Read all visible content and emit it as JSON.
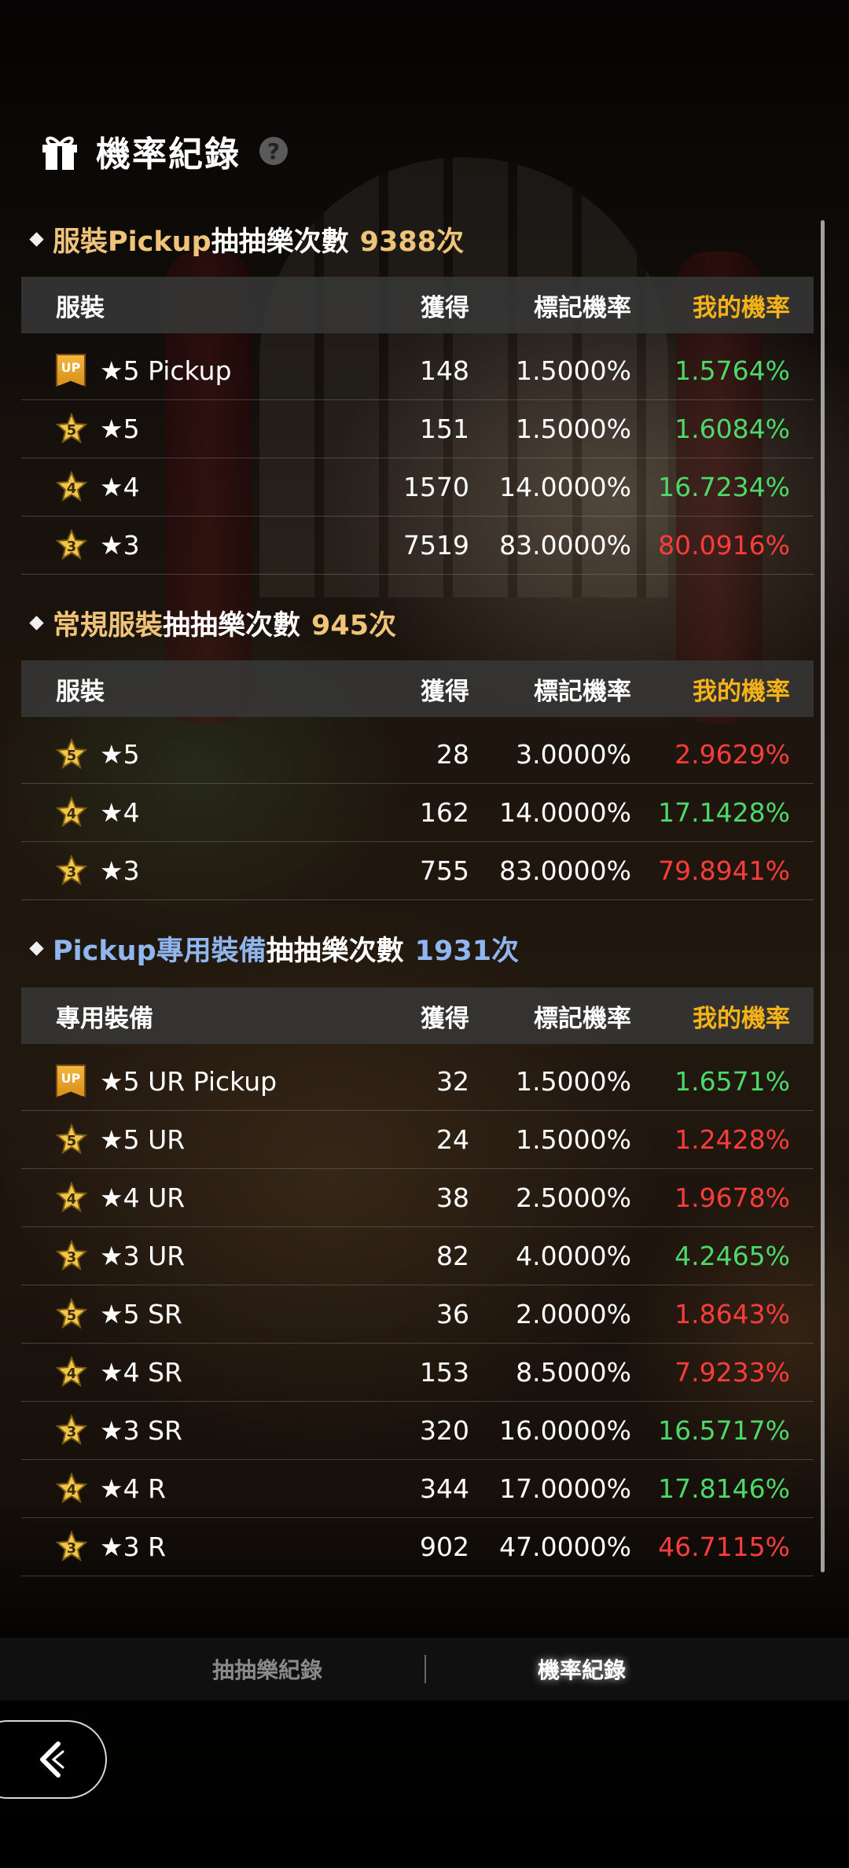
{
  "header": {
    "title": "機率紀錄",
    "help_icon": "question-mark-icon",
    "title_icon": "gift-icon"
  },
  "sections": [
    {
      "title_colored": "服裝Pickup",
      "title_rest": "抽抽樂次數",
      "count": "9388次",
      "title_color": "#efc37a",
      "columns": {
        "name": "服裝",
        "obtained": "獲得",
        "marked_rate": "標記機率",
        "my_rate": "我的機率"
      },
      "rows": [
        {
          "badge": "UP",
          "name": "★5 Pickup",
          "obtained": "148",
          "marked_rate": "1.5000%",
          "my_rate": "1.5764%",
          "my_rate_status": "green"
        },
        {
          "badge": "5",
          "name": "★5",
          "obtained": "151",
          "marked_rate": "1.5000%",
          "my_rate": "1.6084%",
          "my_rate_status": "green"
        },
        {
          "badge": "4",
          "name": "★4",
          "obtained": "1570",
          "marked_rate": "14.0000%",
          "my_rate": "16.7234%",
          "my_rate_status": "green"
        },
        {
          "badge": "3",
          "name": "★3",
          "obtained": "7519",
          "marked_rate": "83.0000%",
          "my_rate": "80.0916%",
          "my_rate_status": "red"
        }
      ]
    },
    {
      "title_colored": "常規服裝",
      "title_rest": "抽抽樂次數",
      "count": "945次",
      "title_color": "#efc37a",
      "columns": {
        "name": "服裝",
        "obtained": "獲得",
        "marked_rate": "標記機率",
        "my_rate": "我的機率"
      },
      "rows": [
        {
          "badge": "5",
          "name": "★5",
          "obtained": "28",
          "marked_rate": "3.0000%",
          "my_rate": "2.9629%",
          "my_rate_status": "red"
        },
        {
          "badge": "4",
          "name": "★4",
          "obtained": "162",
          "marked_rate": "14.0000%",
          "my_rate": "17.1428%",
          "my_rate_status": "green"
        },
        {
          "badge": "3",
          "name": "★3",
          "obtained": "755",
          "marked_rate": "83.0000%",
          "my_rate": "79.8941%",
          "my_rate_status": "red"
        }
      ]
    },
    {
      "title_colored": "Pickup專用裝備",
      "title_rest": "抽抽樂次數",
      "count": "1931次",
      "title_color": "#8fb6ee",
      "columns": {
        "name": "專用裝備",
        "obtained": "獲得",
        "marked_rate": "標記機率",
        "my_rate": "我的機率"
      },
      "rows": [
        {
          "badge": "UP",
          "name": "★5 UR Pickup",
          "obtained": "32",
          "marked_rate": "1.5000%",
          "my_rate": "1.6571%",
          "my_rate_status": "green"
        },
        {
          "badge": "5",
          "name": "★5 UR",
          "obtained": "24",
          "marked_rate": "1.5000%",
          "my_rate": "1.2428%",
          "my_rate_status": "red"
        },
        {
          "badge": "4",
          "name": "★4 UR",
          "obtained": "38",
          "marked_rate": "2.5000%",
          "my_rate": "1.9678%",
          "my_rate_status": "red"
        },
        {
          "badge": "3",
          "name": "★3 UR",
          "obtained": "82",
          "marked_rate": "4.0000%",
          "my_rate": "4.2465%",
          "my_rate_status": "green"
        },
        {
          "badge": "5",
          "name": "★5 SR",
          "obtained": "36",
          "marked_rate": "2.0000%",
          "my_rate": "1.8643%",
          "my_rate_status": "red"
        },
        {
          "badge": "4",
          "name": "★4 SR",
          "obtained": "153",
          "marked_rate": "8.5000%",
          "my_rate": "7.9233%",
          "my_rate_status": "red"
        },
        {
          "badge": "3",
          "name": "★3 SR",
          "obtained": "320",
          "marked_rate": "16.0000%",
          "my_rate": "16.5717%",
          "my_rate_status": "green"
        },
        {
          "badge": "4",
          "name": "★4 R",
          "obtained": "344",
          "marked_rate": "17.0000%",
          "my_rate": "17.8146%",
          "my_rate_status": "green"
        },
        {
          "badge": "3",
          "name": "★3 R",
          "obtained": "902",
          "marked_rate": "47.0000%",
          "my_rate": "46.7115%",
          "my_rate_status": "red"
        }
      ]
    }
  ],
  "tabs": [
    {
      "label": "抽抽樂紀錄",
      "active": false
    },
    {
      "label": "機率紀錄",
      "active": true
    }
  ],
  "back_button": {
    "icon": "back-arrow-icon"
  },
  "colors": {
    "green": "#4cd96a",
    "red": "#ff3c3c",
    "header_mine": "#f5b318"
  }
}
